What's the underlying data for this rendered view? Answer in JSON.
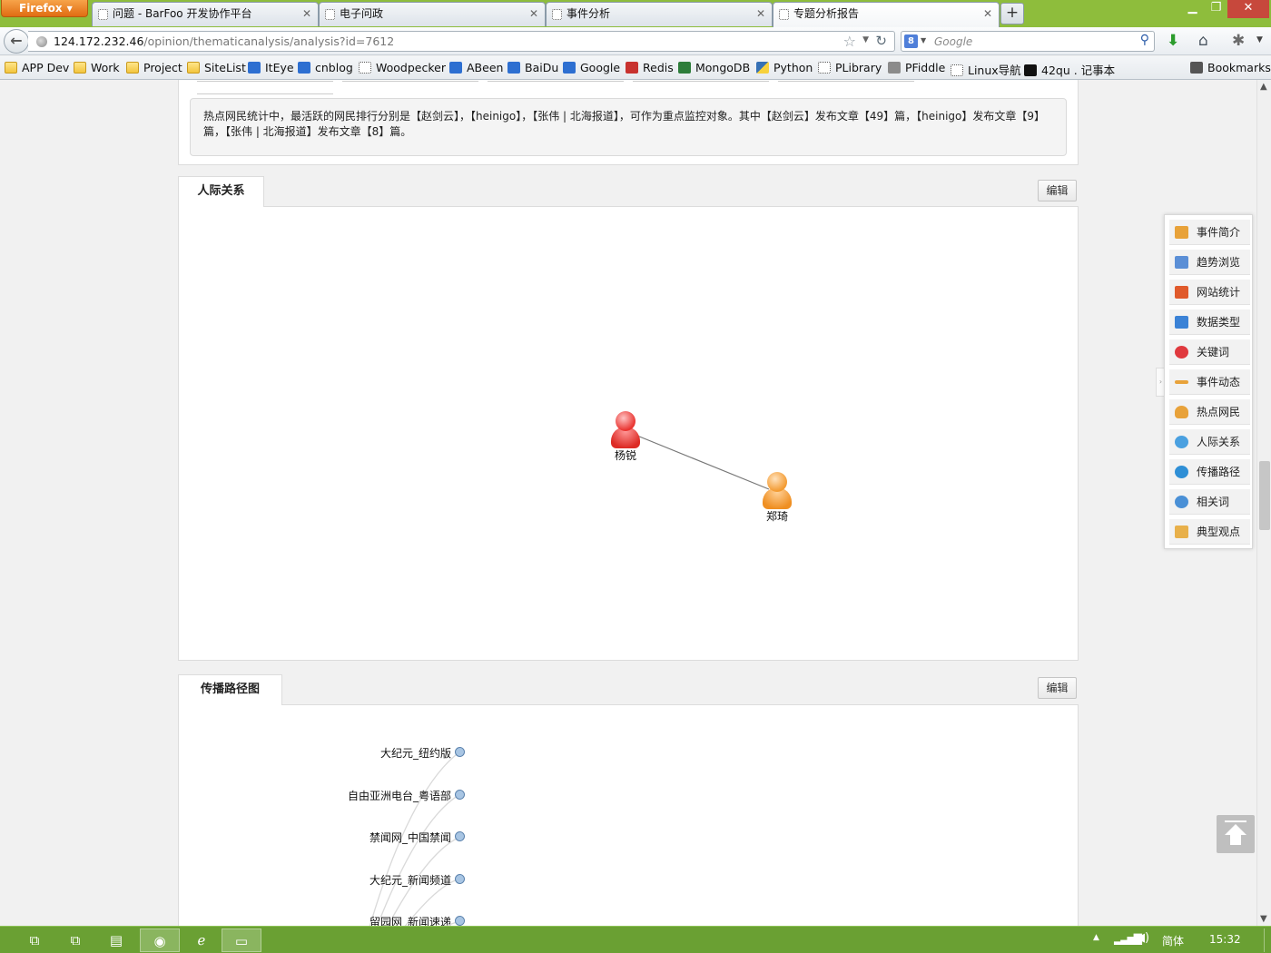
{
  "browser": {
    "app_button": "Firefox",
    "tabs": [
      {
        "title": "问题 - BarFoo 开发协作平台",
        "active": false
      },
      {
        "title": "电子问政",
        "active": false
      },
      {
        "title": "事件分析",
        "active": false
      },
      {
        "title": "专题分析报告",
        "active": true
      }
    ],
    "new_tab_glyph": "+",
    "url_host": "124.172.232.46",
    "url_path": "/opinion/thematicanalysis/analysis?id=7612",
    "search_engine_glyph": "8",
    "search_placeholder": "Google",
    "bookmarks": [
      {
        "label": "APP Dev",
        "icon": "folder-icon"
      },
      {
        "label": "Work",
        "icon": "folder-icon"
      },
      {
        "label": "Project",
        "icon": "folder-icon"
      },
      {
        "label": "SiteList",
        "icon": "folder-icon"
      },
      {
        "label": "ItEye",
        "icon": "iteye-icon"
      },
      {
        "label": "cnblog",
        "icon": "cnblog-icon"
      },
      {
        "label": "Woodpecker",
        "icon": "blank-page-icon"
      },
      {
        "label": "ABeen",
        "icon": "abeen-icon"
      },
      {
        "label": "BaiDu",
        "icon": "baidu-paw-icon"
      },
      {
        "label": "Google",
        "icon": "google-icon"
      },
      {
        "label": "Redis",
        "icon": "redis-icon"
      },
      {
        "label": "MongoDB",
        "icon": "mongodb-leaf-icon"
      },
      {
        "label": "Python",
        "icon": "python-icon"
      },
      {
        "label": "PLibrary",
        "icon": "blank-page-icon"
      },
      {
        "label": "PFiddle",
        "icon": "cloud-icon"
      },
      {
        "label": "Linux导航",
        "icon": "blank-page-icon"
      },
      {
        "label": "42qu . 记事本",
        "icon": "42qu-icon"
      }
    ],
    "bookmarks_menu": "Bookmarks"
  },
  "page": {
    "summary_text": "热点网民统计中，最活跃的网民排行分别是【赵剑云】，【heinigo】，【张伟 | 北海报道】，可作为重点监控对象。其中【赵剑云】发布文章【49】篇，【heinigo】发布文章【9】篇，【张伟 | 北海报道】发布文章【8】篇。",
    "relations": {
      "tab_label": "人际关系",
      "edit_label": "编辑",
      "nodes": [
        {
          "name": "杨锐",
          "color": "red"
        },
        {
          "name": "郑琦",
          "color": "orange"
        }
      ],
      "edges": [
        [
          "杨锐",
          "郑琦"
        ]
      ]
    },
    "spread": {
      "tab_label": "传播路径图",
      "edit_label": "编辑",
      "nodes": [
        "大纪元_纽约版",
        "自由亚洲电台_粤语部",
        "禁闻网_中国禁闻",
        "大纪元_新闻频道",
        "留园网_新闻速递"
      ]
    }
  },
  "float_nav": {
    "items": [
      {
        "label": "事件简介",
        "icon": "book-icon",
        "color": "#e8a23a"
      },
      {
        "label": "趋势浏览",
        "icon": "trend-chart-icon",
        "color": "#5b8fd6"
      },
      {
        "label": "网站统计",
        "icon": "bar-chart-icon",
        "color": "#e05a2b"
      },
      {
        "label": "数据类型",
        "icon": "database-icon",
        "color": "#3b82d6"
      },
      {
        "label": "关键词",
        "icon": "lifebuoy-icon",
        "color": "#e0393e"
      },
      {
        "label": "事件动态",
        "icon": "timeline-icon",
        "color": "#e8a23a"
      },
      {
        "label": "热点网民",
        "icon": "user-icon",
        "color": "#e8a23a"
      },
      {
        "label": "人际关系",
        "icon": "network-icon",
        "color": "#4aa0e0"
      },
      {
        "label": "传播路径",
        "icon": "globe-icon",
        "color": "#2f8fd6"
      },
      {
        "label": "相关词",
        "icon": "broadcast-icon",
        "color": "#4a90d6"
      },
      {
        "label": "典型观点",
        "icon": "thumbs-up-icon",
        "color": "#e8b04a"
      }
    ]
  },
  "taskbar": {
    "ime": "简体",
    "clock": "15:32"
  }
}
